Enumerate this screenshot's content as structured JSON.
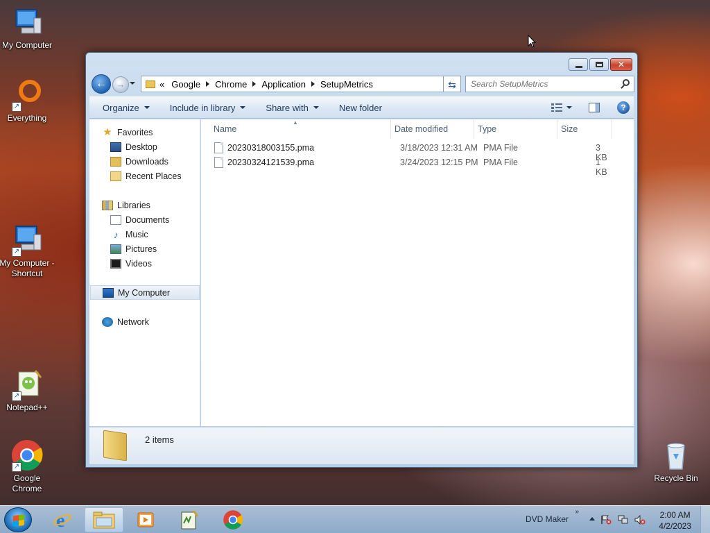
{
  "desktop": {
    "icons": [
      {
        "label": "My Computer"
      },
      {
        "label": "Everything"
      },
      {
        "label": "My Computer - Shortcut"
      },
      {
        "label": "Notepad++"
      },
      {
        "label": "Google Chrome"
      },
      {
        "label": "Recycle Bin"
      }
    ]
  },
  "window": {
    "address": {
      "overflow": "«",
      "crumbs": [
        "Google",
        "Chrome",
        "Application",
        "SetupMetrics"
      ]
    },
    "search": {
      "placeholder": "Search SetupMetrics"
    },
    "toolbar": {
      "organize": "Organize",
      "include_library": "Include in library",
      "share_with": "Share with",
      "new_folder": "New folder"
    },
    "nav": {
      "favorites": "Favorites",
      "desktop": "Desktop",
      "downloads": "Downloads",
      "recent_places": "Recent Places",
      "libraries": "Libraries",
      "documents": "Documents",
      "music": "Music",
      "pictures": "Pictures",
      "videos": "Videos",
      "my_computer": "My Computer",
      "network": "Network"
    },
    "columns": {
      "name": "Name",
      "date": "Date modified",
      "type": "Type",
      "size": "Size"
    },
    "files": [
      {
        "name": "20230318003155.pma",
        "date": "3/18/2023 12:31 AM",
        "type": "PMA File",
        "size": "3 KB"
      },
      {
        "name": "20230324121539.pma",
        "date": "3/24/2023 12:15 PM",
        "type": "PMA File",
        "size": "1 KB"
      }
    ],
    "status": {
      "count": "2 items"
    }
  },
  "taskbar": {
    "tray_label": "DVD Maker",
    "tray_chevron": "»",
    "time": "2:00 AM",
    "date": "4/2/2023"
  },
  "colors": {
    "accent": "#1f63b3",
    "taskbar": "#a9c6e6"
  }
}
